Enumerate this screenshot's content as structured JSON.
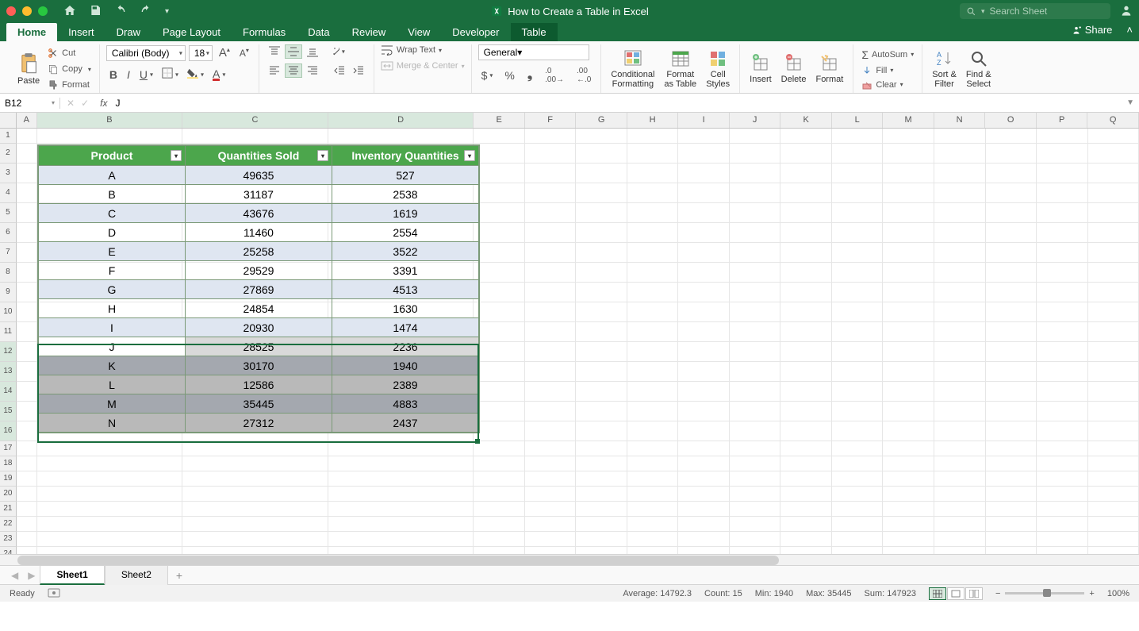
{
  "title_bar": {
    "doc_title": "How to Create a Table in Excel",
    "search_placeholder": "Search Sheet"
  },
  "ribbon_tabs": {
    "tabs": [
      "Home",
      "Insert",
      "Draw",
      "Page Layout",
      "Formulas",
      "Data",
      "Review",
      "View",
      "Developer",
      "Table"
    ],
    "active_index": 0,
    "context_index": 9,
    "share": "Share"
  },
  "ribbon": {
    "paste": "Paste",
    "cut": "Cut",
    "copy": "Copy",
    "format": "Format",
    "font_name": "Calibri (Body)",
    "font_size": "18",
    "wrap": "Wrap Text",
    "merge": "Merge & Center",
    "num_format": "General",
    "cond_fmt": "Conditional",
    "cond_fmt2": "Formatting",
    "fmt_table": "Format",
    "fmt_table2": "as Table",
    "cell_styles": "Cell",
    "cell_styles2": "Styles",
    "insert": "Insert",
    "delete": "Delete",
    "format_cells": "Format",
    "autosum": "AutoSum",
    "fill": "Fill",
    "clear": "Clear",
    "sort": "Sort &",
    "sort2": "Filter",
    "find": "Find &",
    "find2": "Select"
  },
  "name_bar": {
    "cell_ref": "B12",
    "formula_value": "J"
  },
  "columns": [
    "A",
    "B",
    "C",
    "D",
    "E",
    "F",
    "G",
    "H",
    "I",
    "J",
    "K",
    "L",
    "M",
    "N",
    "O",
    "P",
    "Q"
  ],
  "table": {
    "headers": [
      "Product",
      "Quantities Sold",
      "Inventory Quantities"
    ],
    "rows": [
      {
        "p": "A",
        "q": "49635",
        "i": "527"
      },
      {
        "p": "B",
        "q": "31187",
        "i": "2538"
      },
      {
        "p": "C",
        "q": "43676",
        "i": "1619"
      },
      {
        "p": "D",
        "q": "11460",
        "i": "2554"
      },
      {
        "p": "E",
        "q": "25258",
        "i": "3522"
      },
      {
        "p": "F",
        "q": "29529",
        "i": "3391"
      },
      {
        "p": "G",
        "q": "27869",
        "i": "4513"
      },
      {
        "p": "H",
        "q": "24854",
        "i": "1630"
      },
      {
        "p": "I",
        "q": "20930",
        "i": "1474"
      },
      {
        "p": "J",
        "q": "28525",
        "i": "2236"
      },
      {
        "p": "K",
        "q": "30170",
        "i": "1940"
      },
      {
        "p": "L",
        "q": "12586",
        "i": "2389"
      },
      {
        "p": "M",
        "q": "35445",
        "i": "4883"
      },
      {
        "p": "N",
        "q": "27312",
        "i": "2437"
      }
    ],
    "selection_start": 9,
    "selection_end": 13
  },
  "sheets": {
    "tabs": [
      "Sheet1",
      "Sheet2"
    ],
    "active_index": 0
  },
  "status": {
    "ready": "Ready",
    "average": "Average: 14792.3",
    "count": "Count: 15",
    "min": "Min: 1940",
    "max": "Max: 35445",
    "sum": "Sum: 147923",
    "zoom": "100%"
  }
}
